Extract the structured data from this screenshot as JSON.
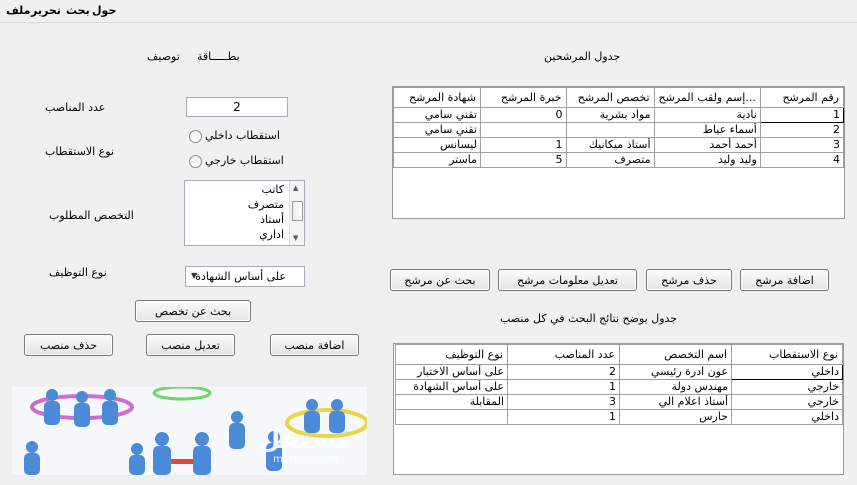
{
  "menu": [
    "ملف",
    "تحرير",
    "بحث",
    "حول"
  ],
  "tabs": {
    "card": "بطـــــاقة",
    "description": "توصيف"
  },
  "candidates_title": "جدول المرشحين",
  "form": {
    "positions_label": "عدد المناصب",
    "positions_value": "2",
    "recruitment_label": "نوع الاستقطاب",
    "radio_internal": "استقطاب داخلي",
    "radio_external": "استقطاب خارجي",
    "specialty_label": "التخصص المطلوب",
    "specialties": [
      "كاتب",
      "متصرف",
      "أستاذ",
      "اداري"
    ],
    "hiring_label": "نوع التوظيف",
    "hiring_value": "على أساس الشهادة"
  },
  "buttons": {
    "search_specialty": "بحث عن تخصص",
    "add_position": "اضافة منصب",
    "edit_position": "تعديل منصب",
    "delete_position": "حذف منصب",
    "add_candidate": "اضافة مرشح",
    "delete_candidate": "حذف مرشح",
    "edit_candidate": "تعديل معلومات مرشح",
    "search_candidate": "بحث عن مرشح"
  },
  "candidates_table": {
    "headers": [
      "شهادة المرشح",
      "خبرة المرشح",
      "تخصص المرشح",
      "إسم ولقب المرشح...",
      "رقم المرشح"
    ],
    "rows": [
      [
        "تقني سامي",
        "0",
        "مواد بشرية",
        "نادية",
        "1"
      ],
      [
        "تقني سامي",
        "",
        "",
        "أسماء عياط",
        "2"
      ],
      [
        "ليسانس",
        "1",
        "أستاذ ميكانيك",
        "أحمد أحمد",
        "3"
      ],
      [
        "ماستر",
        "5",
        "متصرف",
        "وليد وليد",
        "4"
      ]
    ]
  },
  "results_title": "جدول يوضح نتائج البحث في كل منصب",
  "results_table": {
    "headers": [
      "نوع التوظيف",
      "عدد المناصب",
      "اسم التخصص",
      "نوع الاستقطاب"
    ],
    "rows": [
      [
        "على أساس الاختبار",
        "2",
        "عون ادرة رئيسي",
        "داخلي"
      ],
      [
        "على أساس الشهادة",
        "1",
        "مهندس دولة",
        "خارجي"
      ],
      [
        "المقابلة",
        "3",
        "أستاذ اعلام الي",
        "خارجي"
      ],
      [
        "",
        "1",
        "حارس",
        "داخلي"
      ]
    ]
  },
  "watermark": {
    "main": "مستقل",
    "sub": "mostaqi.com"
  },
  "colors": {
    "window_bg": "#f0f0f0",
    "grid_border": "#a0a0a0"
  }
}
